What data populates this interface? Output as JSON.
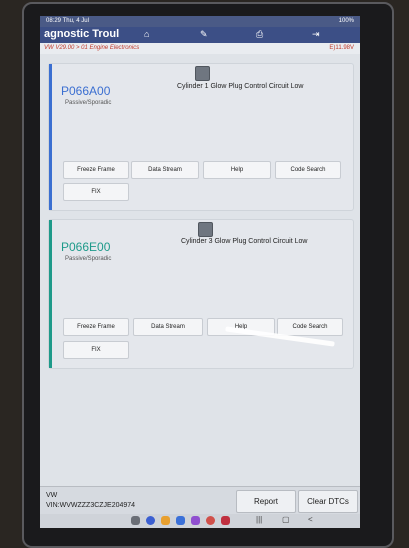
{
  "status_bar": {
    "time": "08:29  Thu, 4 Jul",
    "battery": "100%"
  },
  "header": {
    "title": "agnostic Troul"
  },
  "crumb": {
    "path": "VW V29.00 > 01 Engine Electronics",
    "voltage": "E)11.98V"
  },
  "dtcs": [
    {
      "code": "P066A00",
      "status": "Passive/Sporadic",
      "description": "Cylinder 1 Glow Plug Control Circuit Low",
      "accent": "#3b6fd1",
      "code_color": "#3b6fd1",
      "buttons": {
        "freeze": "Freeze Frame",
        "stream": "Data Stream",
        "help": "Help",
        "search": "Code Search",
        "fix": "FIX"
      }
    },
    {
      "code": "P066E00",
      "status": "Passive/Sporadic",
      "description": "Cylinder 3 Glow Plug Control Circuit Low",
      "accent": "#1e9a8a",
      "code_color": "#1e9a8a",
      "buttons": {
        "freeze": "Freeze Frame",
        "stream": "Data Stream",
        "help": "Help",
        "search": "Code Search",
        "fix": "FIX"
      }
    }
  ],
  "footer": {
    "make": "VW",
    "vin": "VIN:WVWZZZ3CZJE204974",
    "report": "Report",
    "clear": "Clear DTCs"
  }
}
